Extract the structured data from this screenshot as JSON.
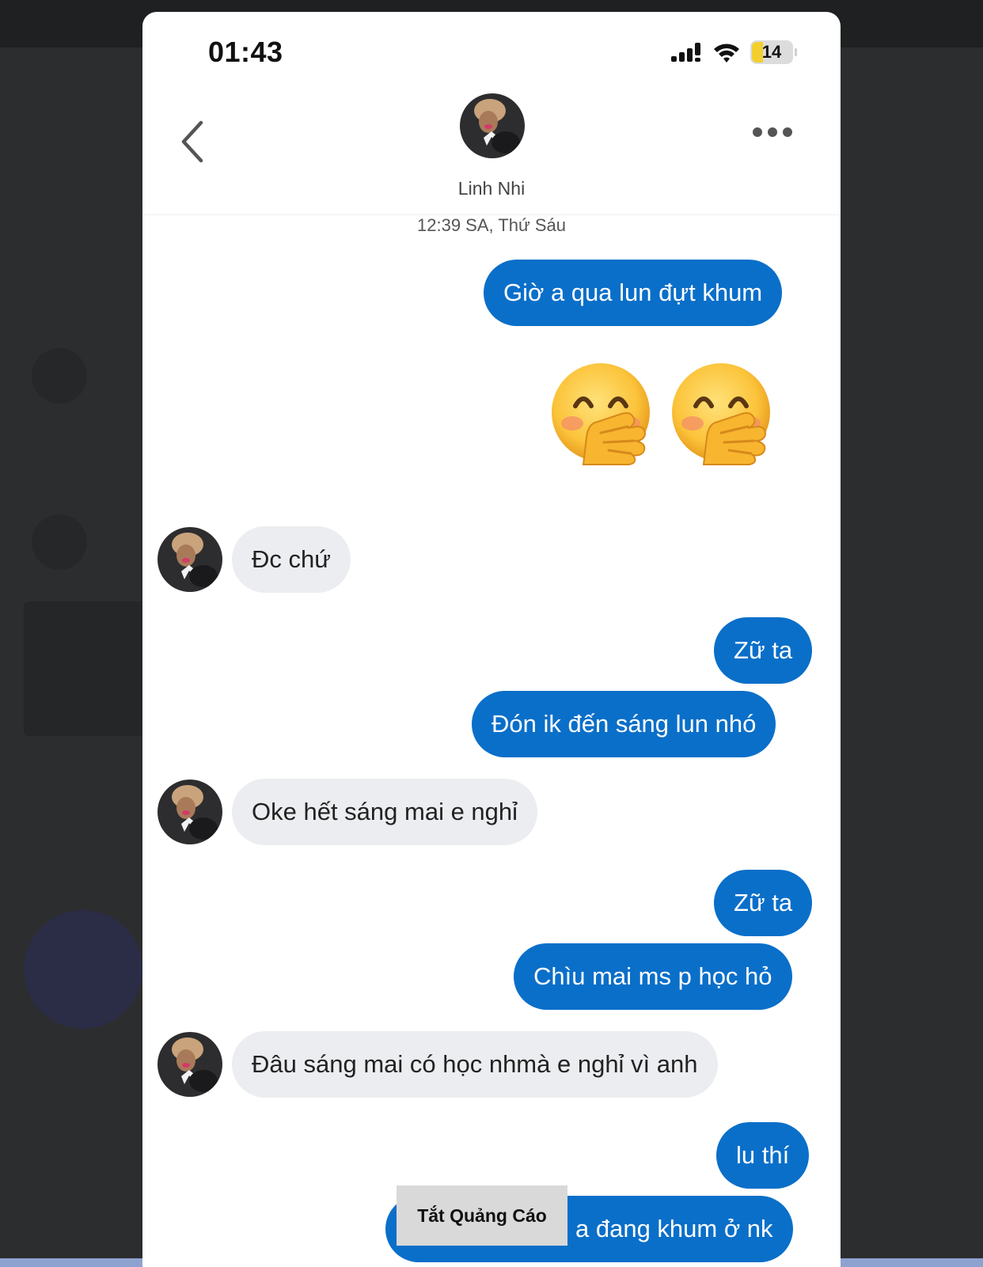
{
  "status_bar": {
    "time": "01:43",
    "battery_level": "14",
    "signal_icon": "cellular-signal-icon",
    "wifi_icon": "wifi-icon",
    "battery_color": "#f2cf2e"
  },
  "header": {
    "contact_name": "Linh Nhi",
    "back_icon": "chevron-left-icon",
    "more_icon": "ellipsis-icon"
  },
  "conversation": {
    "timestamp": "12:39 SA, Thứ Sáu",
    "messages": [
      {
        "direction": "outgoing",
        "text": "Giờ a qua lun đựt khum"
      },
      {
        "direction": "outgoing",
        "emoji": "face-with-hand-over-mouth",
        "count": 2
      },
      {
        "direction": "incoming",
        "text": "Đc chứ"
      },
      {
        "direction": "outgoing",
        "text": "Zữ ta"
      },
      {
        "direction": "outgoing",
        "text": "Đón ik đến sáng lun nhó"
      },
      {
        "direction": "incoming",
        "text": "Oke hết sáng mai e nghỉ"
      },
      {
        "direction": "outgoing",
        "text": "Zữ ta"
      },
      {
        "direction": "outgoing",
        "text": "Chìu mai ms p học hỏ"
      },
      {
        "direction": "incoming",
        "text": "Đâu sáng mai có học nhmà e nghỉ vì anh"
      },
      {
        "direction": "outgoing",
        "text": "lu thí"
      },
      {
        "direction": "outgoing",
        "text": "a đang khum ở nk"
      }
    ]
  },
  "ad_banner": {
    "label": "Tắt Quảng Cáo"
  },
  "colors": {
    "outgoing_bubble": "#0a6fc9",
    "incoming_bubble": "#ecedf0",
    "background": "#ffffff"
  }
}
